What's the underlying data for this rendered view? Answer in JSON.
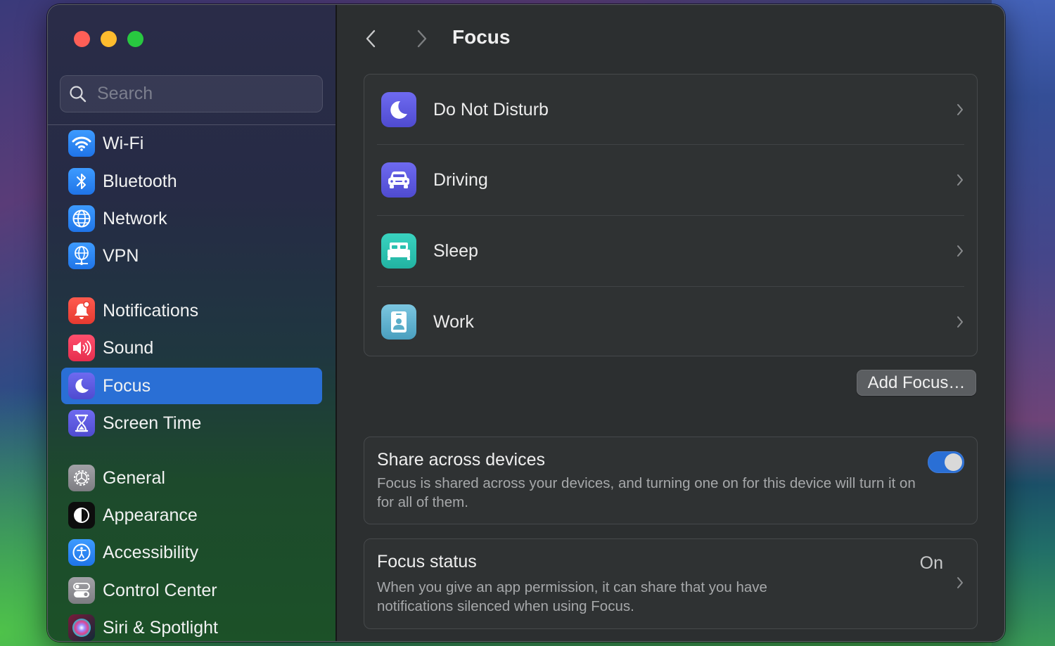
{
  "window": {
    "controls": {
      "close": "close",
      "minimize": "minimize",
      "zoom": "zoom"
    }
  },
  "sidebar": {
    "search": {
      "placeholder": "Search",
      "value": ""
    },
    "items": [
      {
        "label": "Wi-Fi",
        "icon": "wifi-icon",
        "color": "#2f8af5",
        "active": false
      },
      {
        "label": "Bluetooth",
        "icon": "bluetooth-icon",
        "color": "#2f8af5",
        "active": false
      },
      {
        "label": "Network",
        "icon": "globe-icon",
        "color": "#2f8af5",
        "active": false
      },
      {
        "label": "VPN",
        "icon": "vpn-globe-icon",
        "color": "#2f8af5",
        "active": false
      },
      {
        "label": "Notifications",
        "icon": "bell-icon",
        "color": "#f0463c",
        "active": false
      },
      {
        "label": "Sound",
        "icon": "speaker-icon",
        "color": "#f0395a",
        "active": false
      },
      {
        "label": "Focus",
        "icon": "moon-icon",
        "color": "#5b57d8",
        "active": true
      },
      {
        "label": "Screen Time",
        "icon": "hourglass-icon",
        "color": "#5b57d8",
        "active": false
      },
      {
        "label": "General",
        "icon": "gear-icon",
        "color": "#8e8e93",
        "active": false
      },
      {
        "label": "Appearance",
        "icon": "appearance-icon",
        "color": "#111111",
        "active": false
      },
      {
        "label": "Accessibility",
        "icon": "accessibility-icon",
        "color": "#2f8af5",
        "active": false
      },
      {
        "label": "Control Center",
        "icon": "toggles-icon",
        "color": "#8e8e93",
        "active": false
      },
      {
        "label": "Siri & Spotlight",
        "icon": "siri-icon",
        "color": "#1a1a2e",
        "active": false
      }
    ]
  },
  "main": {
    "title": "Focus",
    "focus_modes": [
      {
        "label": "Do Not Disturb",
        "icon": "moon-icon",
        "color": "#5b57d8"
      },
      {
        "label": "Driving",
        "icon": "car-icon",
        "color": "#5b57d8"
      },
      {
        "label": "Sleep",
        "icon": "bed-icon",
        "color": "#2fc4b2"
      },
      {
        "label": "Work",
        "icon": "id-badge-icon",
        "color": "#5aaec9"
      }
    ],
    "add_focus_label": "Add Focus…",
    "share": {
      "title": "Share across devices",
      "description": "Focus is shared across your devices, and turning one on for this device will turn it on for all of them.",
      "enabled": true
    },
    "status": {
      "title": "Focus status",
      "value": "On",
      "description": "When you give an app permission, it can share that you have notifications silenced when using Focus."
    }
  },
  "colors": {
    "accent": "#2a6fd5",
    "main_bg": "#2c2f30",
    "group_bg": "#2f3233"
  }
}
